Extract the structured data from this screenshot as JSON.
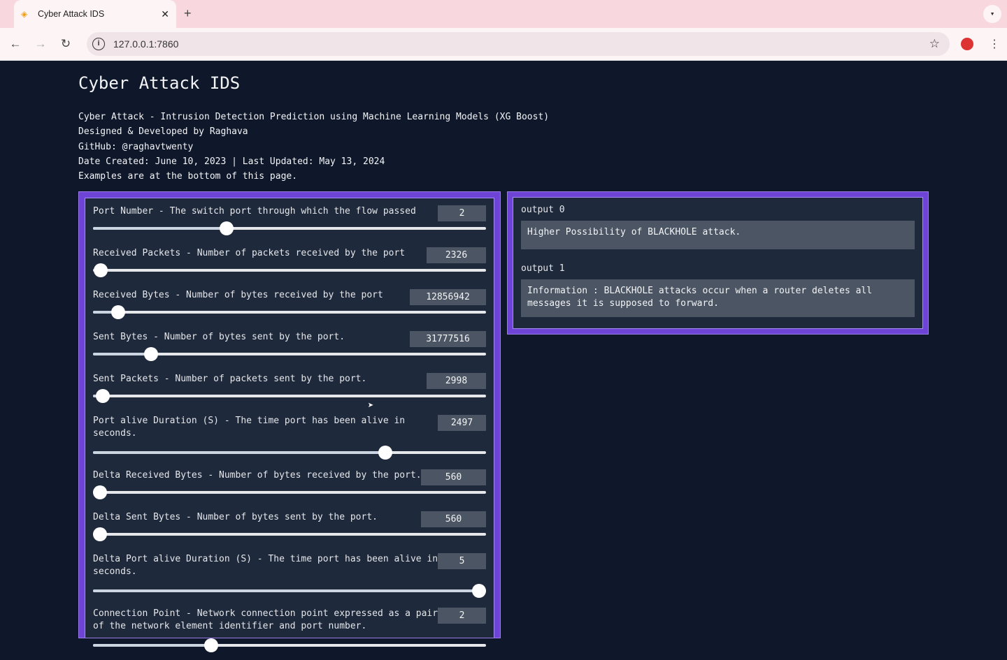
{
  "browser": {
    "tab_title": "Cyber Attack IDS",
    "url": "127.0.0.1:7860"
  },
  "page": {
    "title": "Cyber Attack IDS",
    "description": [
      "Cyber Attack - Intrusion Detection Prediction using Machine Learning Models (XG Boost)",
      "Designed & Developed by Raghava",
      "GitHub: @raghavtwenty",
      "Date Created: June 10, 2023 | Last Updated: May 13, 2024",
      "Examples are at the bottom of this page."
    ]
  },
  "inputs": [
    {
      "label": "Port Number - The switch port through which the flow passed",
      "value": "2",
      "slider_fraction": 0.34,
      "box_w": 69
    },
    {
      "label": "Received Packets - Number of packets received by the port",
      "value": "2326",
      "slider_fraction": 0.02,
      "box_w": 85
    },
    {
      "label": "Received Bytes - Number of bytes received by the port",
      "value": "12856942",
      "slider_fraction": 0.064,
      "box_w": 109
    },
    {
      "label": "Sent Bytes - Number of bytes sent by the port.",
      "value": "31777516",
      "slider_fraction": 0.147,
      "box_w": 109
    },
    {
      "label": "Sent Packets - Number of packets sent by the port.",
      "value": "2998",
      "slider_fraction": 0.025,
      "box_w": 85
    },
    {
      "label": "Port alive Duration (S) - The time port has been alive in seconds.",
      "value": "2497",
      "slider_fraction": 0.744,
      "box_w": 69
    },
    {
      "label": "Delta Received Bytes - Number of bytes received by the port.",
      "value": "560",
      "slider_fraction": 0.0,
      "box_w": 93
    },
    {
      "label": "Delta Sent Bytes - Number of bytes sent by the port.",
      "value": "560",
      "slider_fraction": 0.0,
      "box_w": 93
    },
    {
      "label": "Delta Port alive Duration (S) - The time port has been alive in seconds.",
      "value": "5",
      "slider_fraction": 1.0,
      "box_w": 69
    },
    {
      "label": "Connection Point - Network connection point expressed as a pair of the network element identifier and port number.",
      "value": "2",
      "slider_fraction": 0.3,
      "box_w": 69
    }
  ],
  "outputs": [
    {
      "label": "output 0",
      "value": "Higher Possibility of BLACKHOLE attack."
    },
    {
      "label": "output 1",
      "value": "Information : BLACKHOLE attacks occur when a router deletes all messages it is supposed to forward."
    }
  ],
  "colors": {
    "background": "#0f172a",
    "panel": "#1e293b",
    "border": "#6d44d6",
    "input": "#4b5563"
  }
}
